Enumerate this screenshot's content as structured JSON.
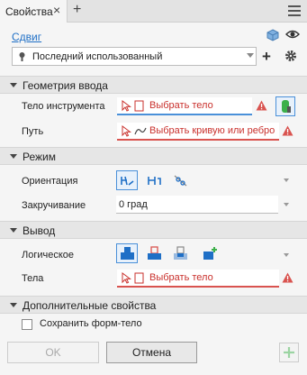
{
  "tab": {
    "title": "Свойства",
    "close": "×",
    "add": "+"
  },
  "mode_link": "Сдвиг",
  "preset": {
    "value": "Последний использованный"
  },
  "sections": {
    "input_geometry": {
      "title": "Геометрия ввода",
      "tool_body_label": "Тело инструмента",
      "tool_body_prompt": "Выбрать тело",
      "path_label": "Путь",
      "path_prompt": "Выбрать кривую или ребро"
    },
    "mode": {
      "title": "Режим",
      "orientation_label": "Ориентация",
      "twist_label": "Закручивание",
      "twist_value": "0 град"
    },
    "output": {
      "title": "Вывод",
      "boolean_label": "Логическое",
      "bodies_label": "Тела",
      "bodies_prompt": "Выбрать тело"
    },
    "advanced": {
      "title": "Дополнительные свойства",
      "keep_tool_body_label": "Сохранить форм-тело"
    }
  },
  "footer": {
    "ok": "OK",
    "cancel": "Отмена"
  },
  "colors": {
    "accent": "#4a90d9",
    "error": "#d9534f",
    "link": "#1f6fc6",
    "green": "#3cb04a"
  },
  "icons": [
    "close-icon",
    "add-tab-icon",
    "menu-icon",
    "cube-icon",
    "eye-icon",
    "preset-icon",
    "add-preset-icon",
    "gear-icon",
    "select-arrow-icon",
    "curve-icon",
    "warning-icon",
    "green-body-icon",
    "orientation-path-icon",
    "orientation-fixed-icon",
    "orientation-parallel-icon",
    "boolean-join-icon",
    "boolean-cut-icon",
    "boolean-intersect-icon",
    "new-solid-icon",
    "apply-plus-icon"
  ]
}
